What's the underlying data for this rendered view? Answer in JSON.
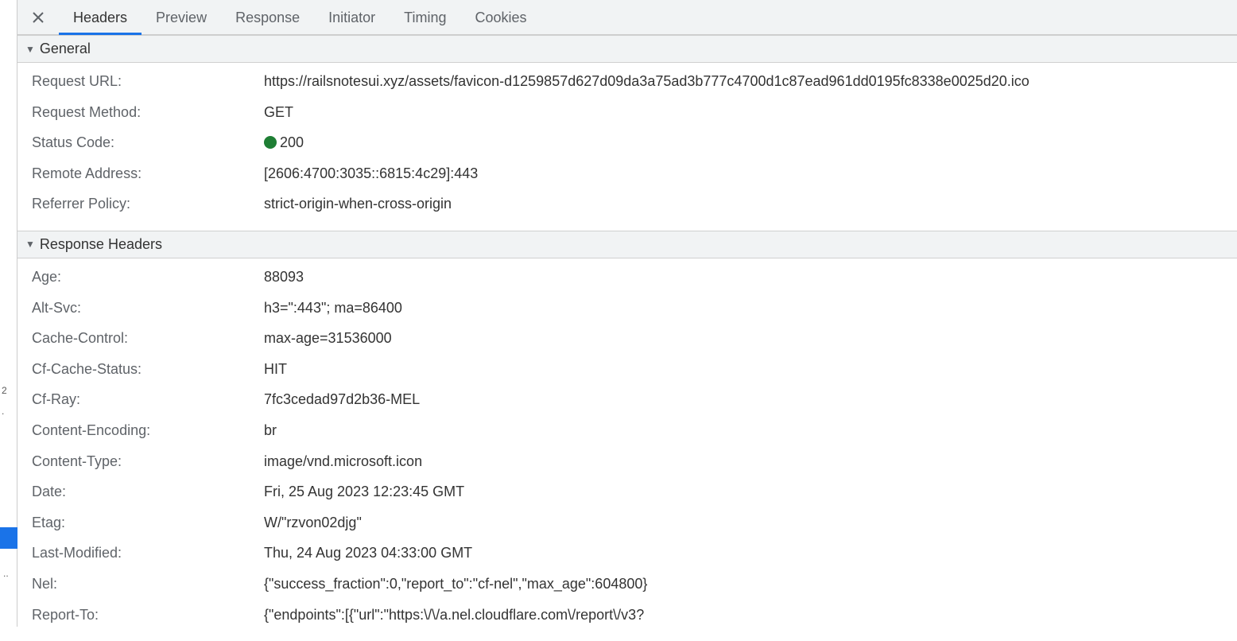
{
  "gutter": {
    "mark_a": "2",
    "mark_b": ".",
    "dots": ".."
  },
  "tabs": [
    "Headers",
    "Preview",
    "Response",
    "Initiator",
    "Timing",
    "Cookies"
  ],
  "active_tab": "Headers",
  "sections": {
    "general": {
      "title": "General",
      "rows": [
        {
          "k": "Request URL:",
          "v": "https://railsnotesui.xyz/assets/favicon-d1259857d627d09da3a75ad3b777c4700d1c87ead961dd0195fc8338e0025d20.ico"
        },
        {
          "k": "Request Method:",
          "v": "GET"
        },
        {
          "k": "Status Code:",
          "v": "200",
          "status_dot": true
        },
        {
          "k": "Remote Address:",
          "v": "[2606:4700:3035::6815:4c29]:443"
        },
        {
          "k": "Referrer Policy:",
          "v": "strict-origin-when-cross-origin"
        }
      ]
    },
    "response_headers": {
      "title": "Response Headers",
      "rows": [
        {
          "k": "Age:",
          "v": "88093"
        },
        {
          "k": "Alt-Svc:",
          "v": "h3=\":443\"; ma=86400"
        },
        {
          "k": "Cache-Control:",
          "v": "max-age=31536000"
        },
        {
          "k": "Cf-Cache-Status:",
          "v": "HIT"
        },
        {
          "k": "Cf-Ray:",
          "v": "7fc3cedad97d2b36-MEL"
        },
        {
          "k": "Content-Encoding:",
          "v": "br"
        },
        {
          "k": "Content-Type:",
          "v": "image/vnd.microsoft.icon"
        },
        {
          "k": "Date:",
          "v": "Fri, 25 Aug 2023 12:23:45 GMT"
        },
        {
          "k": "Etag:",
          "v": "W/\"rzvon02djg\""
        },
        {
          "k": "Last-Modified:",
          "v": "Thu, 24 Aug 2023 04:33:00 GMT"
        },
        {
          "k": "Nel:",
          "v": "{\"success_fraction\":0,\"report_to\":\"cf-nel\",\"max_age\":604800}"
        },
        {
          "k": "Report-To:",
          "v": "{\"endpoints\":[{\"url\":\"https:\\/\\/a.nel.cloudflare.com\\/report\\/v3?"
        }
      ]
    }
  }
}
